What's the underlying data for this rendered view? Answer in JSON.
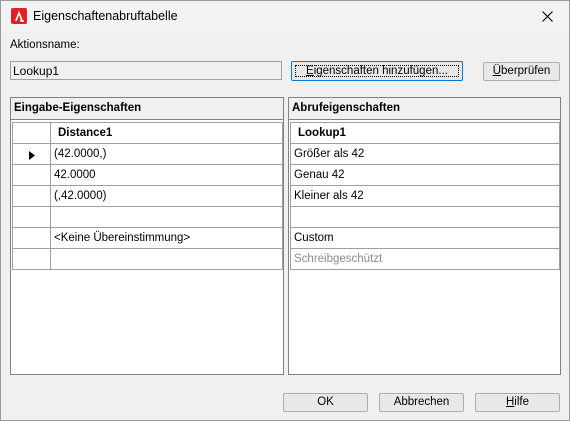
{
  "window": {
    "title": "Eigenschaftenabruftabelle"
  },
  "action": {
    "label": "Aktionsname:",
    "value": "Lookup1",
    "add_properties_button": "Eigenschaften hinzufügen...",
    "check_button": "Überprüfen"
  },
  "input_panel": {
    "header": "Eingabe-Eigenschaften",
    "column": "Distance1",
    "rows": [
      "(42.0000,)",
      "42.0000",
      "(,42.0000)",
      "",
      "<Keine Übereinstimmung>",
      ""
    ]
  },
  "lookup_panel": {
    "header": "Abrufeigenschaften",
    "column": "Lookup1",
    "rows": [
      "Größer als 42",
      "Genau 42",
      "Kleiner als 42",
      "",
      "Custom",
      "Schreibgeschützt"
    ]
  },
  "footer": {
    "ok": "OK",
    "cancel": "Abbrechen",
    "help": "Hilfe"
  },
  "icons": {
    "app": "autocad-logo-icon",
    "close": "close-icon",
    "row_pointer": "row-pointer-icon"
  },
  "colors": {
    "app_icon": "#e51e25",
    "focus_border": "#0078d7"
  }
}
